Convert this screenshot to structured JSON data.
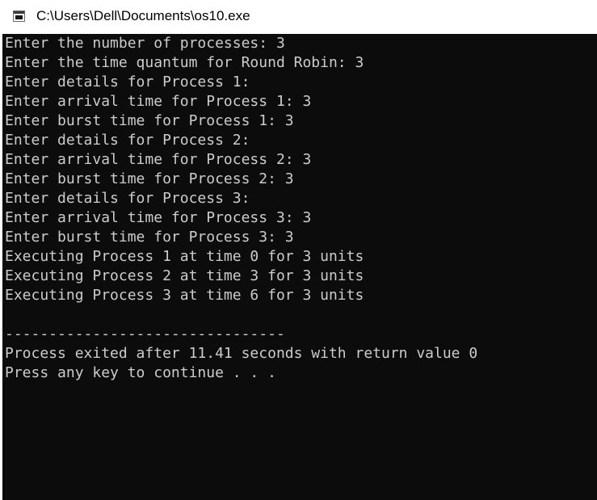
{
  "window": {
    "title": "C:\\Users\\Dell\\Documents\\os10.exe",
    "icon": "console-app-icon"
  },
  "console": {
    "text_color": "#cccccc",
    "background_color": "#0c0c0c",
    "lines": [
      "Enter the number of processes: 3",
      "Enter the time quantum for Round Robin: 3",
      "Enter details for Process 1:",
      "Enter arrival time for Process 1: 3",
      "Enter burst time for Process 1: 3",
      "Enter details for Process 2:",
      "Enter arrival time for Process 2: 3",
      "Enter burst time for Process 2: 3",
      "Enter details for Process 3:",
      "Enter arrival time for Process 3: 3",
      "Enter burst time for Process 3: 3",
      "Executing Process 1 at time 0 for 3 units",
      "Executing Process 2 at time 3 for 3 units",
      "Executing Process 3 at time 6 for 3 units",
      "",
      "--------------------------------",
      "Process exited after 11.41 seconds with return value 0",
      "Press any key to continue . . ."
    ]
  }
}
